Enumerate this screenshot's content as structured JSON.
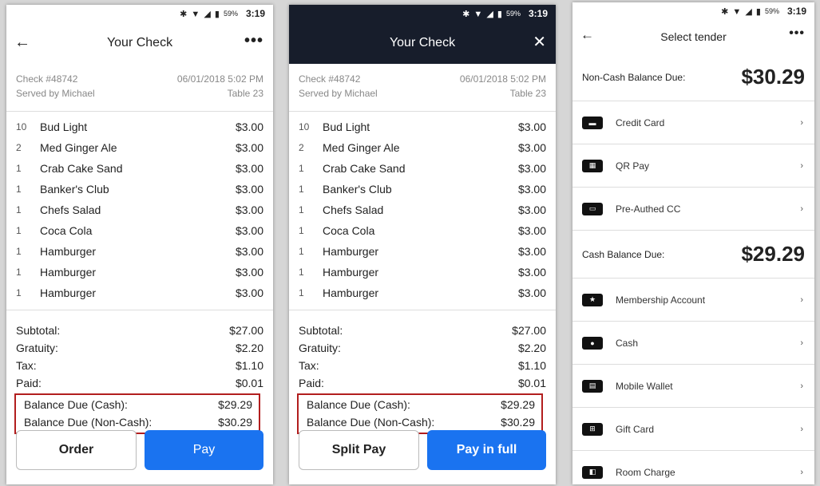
{
  "status": {
    "icons": "✱ ▼ ◢ ▮",
    "battery": "59%",
    "time": "3:19"
  },
  "screen1": {
    "title": "Your Check",
    "back_icon": "←",
    "menu_icon": "•••",
    "check_number": "Check #48742",
    "date": "06/01/2018 5:02 PM",
    "served_by": "Served by Michael",
    "table": "Table 23",
    "items": [
      {
        "qty": "10",
        "name": "Bud Light",
        "price": "$3.00"
      },
      {
        "qty": "2",
        "name": "Med Ginger Ale",
        "price": "$3.00"
      },
      {
        "qty": "1",
        "name": "Crab Cake Sand",
        "price": "$3.00"
      },
      {
        "qty": "1",
        "name": "Banker's Club",
        "price": "$3.00"
      },
      {
        "qty": "1",
        "name": "Chefs Salad",
        "price": "$3.00"
      },
      {
        "qty": "1",
        "name": "Coca Cola",
        "price": "$3.00"
      },
      {
        "qty": "1",
        "name": "Hamburger",
        "price": "$3.00"
      },
      {
        "qty": "1",
        "name": "Hamburger",
        "price": "$3.00"
      },
      {
        "qty": "1",
        "name": "Hamburger",
        "price": "$3.00"
      }
    ],
    "totals": [
      {
        "label": "Subtotal:",
        "value": "$27.00"
      },
      {
        "label": "Gratuity:",
        "value": "$2.20"
      },
      {
        "label": "Tax:",
        "value": "$1.10"
      },
      {
        "label": "Paid:",
        "value": "$0.01"
      }
    ],
    "balance_cash_label": "Balance Due (Cash):",
    "balance_cash": "$29.29",
    "balance_noncash_label": "Balance Due (Non-Cash):",
    "balance_noncash": "$30.29",
    "btn_left": "Order",
    "btn_right": "Pay"
  },
  "screen2": {
    "title": "Your Check",
    "close_icon": "✕",
    "btn_left": "Split Pay",
    "btn_right": "Pay in full"
  },
  "screen3": {
    "title": "Select tender",
    "back_icon": "←",
    "menu_icon": "•••",
    "noncash_label": "Non-Cash Balance Due:",
    "noncash_amount": "$30.29",
    "cash_label": "Cash Balance Due:",
    "cash_amount": "$29.29",
    "noncash_tenders": [
      {
        "label": "Credit Card",
        "icon": "credit-card-icon"
      },
      {
        "label": "QR Pay",
        "icon": "qr-icon"
      },
      {
        "label": "Pre-Authed CC",
        "icon": "pre-authed-card-icon"
      }
    ],
    "cash_tenders": [
      {
        "label": "Membership Account",
        "icon": "star-card-icon"
      },
      {
        "label": "Cash",
        "icon": "cash-icon"
      },
      {
        "label": "Mobile Wallet",
        "icon": "wallet-icon"
      },
      {
        "label": "Gift Card",
        "icon": "gift-icon"
      },
      {
        "label": "Room Charge",
        "icon": "room-key-icon"
      }
    ],
    "chevron": "›"
  }
}
